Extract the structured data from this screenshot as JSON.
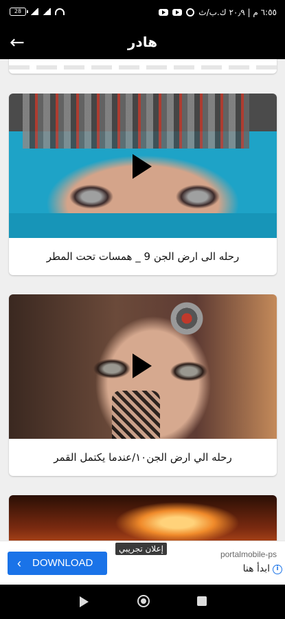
{
  "status": {
    "battery": "28",
    "time": "٦:٥٥ م | ٢٠٫٩ ك.ب/ث"
  },
  "appbar": {
    "title": "هادر"
  },
  "cards": [
    {
      "title": "رحله الى ارض الجن 9 _ همسات تحت المطر"
    },
    {
      "title": "رحله الي ارض الجن١٠/عندما يكتمل القمر"
    }
  ],
  "ad": {
    "download_label": "DOWNLOAD",
    "label": "إعلان تجريبي",
    "host": "portalmobile-ps",
    "cta": "ابدأ هنا",
    "accent": "#1a73e8"
  }
}
